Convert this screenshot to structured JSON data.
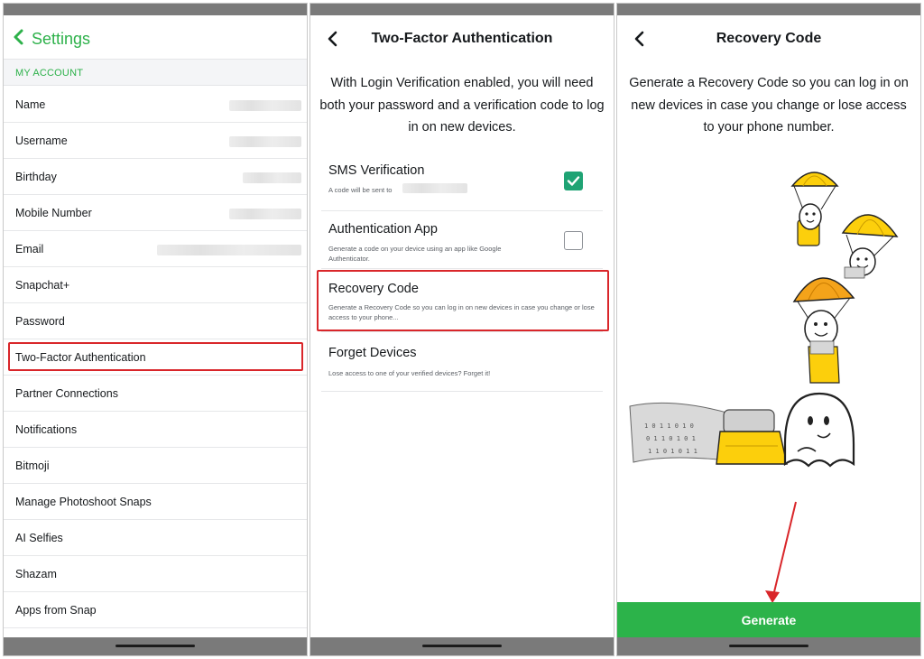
{
  "settings": {
    "title": "Settings",
    "section": "MY ACCOUNT",
    "items": [
      {
        "label": "Name"
      },
      {
        "label": "Username"
      },
      {
        "label": "Birthday"
      },
      {
        "label": "Mobile Number"
      },
      {
        "label": "Email"
      },
      {
        "label": "Snapchat+"
      },
      {
        "label": "Password"
      },
      {
        "label": "Two-Factor Authentication"
      },
      {
        "label": "Partner Connections"
      },
      {
        "label": "Notifications"
      },
      {
        "label": "Bitmoji"
      },
      {
        "label": "Manage Photoshoot Snaps"
      },
      {
        "label": "AI Selfies"
      },
      {
        "label": "Shazam"
      },
      {
        "label": "Apps from Snap"
      }
    ]
  },
  "two_factor": {
    "title": "Two-Factor Authentication",
    "intro": "With Login Verification enabled, you will need both your password and a verification code to log in on new devices.",
    "options": [
      {
        "title": "SMS Verification",
        "desc": "A code will be sent to",
        "checked": true
      },
      {
        "title": "Authentication App",
        "desc": "Generate a code on your device using an app like Google Authenticator.",
        "checked": false
      },
      {
        "title": "Recovery Code",
        "desc": "Generate a Recovery Code so you can log in on new devices in case you change or lose access to your phone..."
      },
      {
        "title": "Forget Devices",
        "desc": "Lose access to one of your verified devices? Forget it!"
      }
    ]
  },
  "recovery": {
    "title": "Recovery Code",
    "intro": "Generate a Recovery Code so you can log in on new devices in case you change or lose access to your phone number.",
    "button": "Generate"
  },
  "colors": {
    "accent_green": "#2db14a",
    "check_green": "#1fa374",
    "highlight_red": "#d9262a",
    "ghost_yellow": "#fccf0c"
  },
  "icons": {
    "back": "chevron-left-icon",
    "check": "checkmark-icon"
  }
}
